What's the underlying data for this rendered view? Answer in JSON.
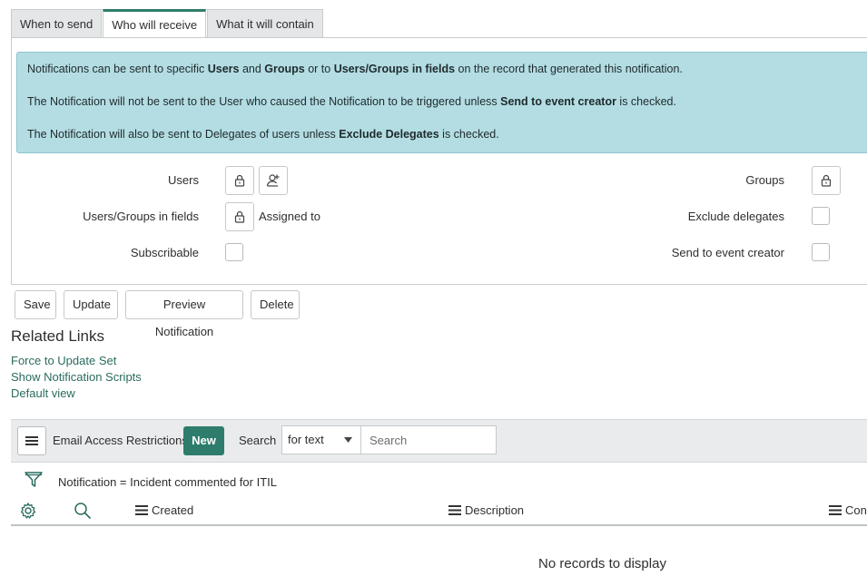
{
  "tabs": [
    {
      "label": "When to send"
    },
    {
      "label": "Who will receive"
    },
    {
      "label": "What it will contain"
    }
  ],
  "info": {
    "line1": {
      "t1": "Notifications can be sent to specific ",
      "b1": "Users",
      "t2": " and ",
      "b2": "Groups",
      "t3": " or to ",
      "b3": "Users/Groups in fields",
      "t4": " on the record that generated this notification."
    },
    "line2": {
      "t1": "The Notification will not be sent to the User who caused the Notification to be triggered unless ",
      "b1": "Send to event creator",
      "t2": " is checked."
    },
    "line3": {
      "t1": "The Notification will also be sent to Delegates of users unless ",
      "b1": "Exclude Delegates",
      "t2": " is checked."
    }
  },
  "form": {
    "users_label": "Users",
    "groups_label": "Groups",
    "users_fields_label": "Users/Groups in fields",
    "users_fields_value": "Assigned to",
    "exclude_delegates_label": "Exclude delegates",
    "subscribable_label": "Subscribable",
    "send_to_creator_label": "Send to event creator"
  },
  "actions": {
    "save": "Save",
    "update": "Update",
    "preview": "Preview Notification",
    "delete": "Delete"
  },
  "related_links": {
    "title": "Related Links",
    "links": [
      "Force to Update Set",
      "Show Notification Scripts",
      "Default view"
    ]
  },
  "list": {
    "title": "Email Access Restrictions",
    "new_label": "New",
    "search_label": "Search",
    "search_select": "for text",
    "search_placeholder": "Search",
    "filter_text": "Notification = Incident commented for ITIL",
    "columns": [
      "Created",
      "Description",
      "Conditions"
    ],
    "empty_text": "No records to display"
  },
  "colors": {
    "accent": "#2e7d6c",
    "info_bg": "#b3dde3",
    "link": "#2a6b5e"
  }
}
